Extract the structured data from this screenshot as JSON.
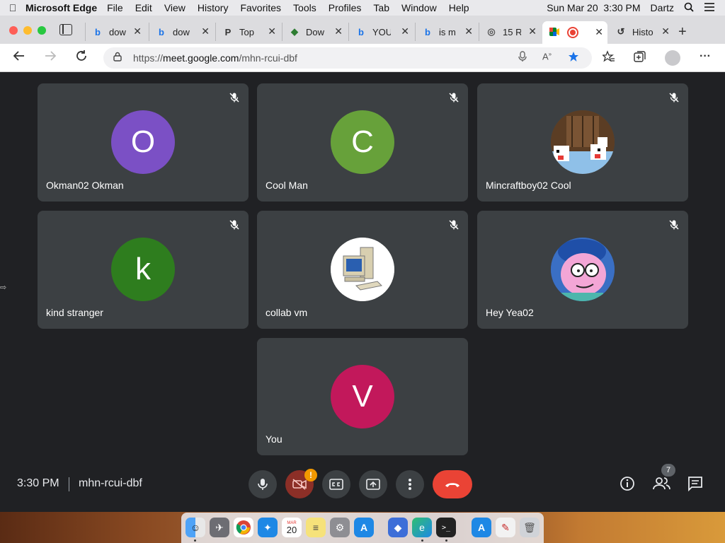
{
  "menubar": {
    "app_name": "Microsoft Edge",
    "items": [
      "File",
      "Edit",
      "View",
      "History",
      "Favorites",
      "Tools",
      "Profiles",
      "Tab",
      "Window",
      "Help"
    ],
    "datetime": "Sun Mar 20  3:30 PM",
    "user": "Dartz"
  },
  "tabs": [
    {
      "title": "dow",
      "icon": "bing-icon"
    },
    {
      "title": "dow",
      "icon": "bing-icon"
    },
    {
      "title": "Top",
      "icon": "page-icon"
    },
    {
      "title": "Dow",
      "icon": "download-icon"
    },
    {
      "title": "YOU",
      "icon": "bing-icon"
    },
    {
      "title": "is m",
      "icon": "bing-icon"
    },
    {
      "title": "15 R",
      "icon": "site-icon"
    },
    {
      "title": "",
      "icon": "google-meet-icon",
      "active": true
    },
    {
      "title": "Histo",
      "icon": "history-icon"
    }
  ],
  "address": {
    "url_prefix": "https://",
    "url_host": "meet.google.com",
    "url_path": "/mhn-rcui-dbf"
  },
  "participants": [
    {
      "name": "Okman02 Okman",
      "initial": "O",
      "color": "#7b50c5",
      "avatar": "initial"
    },
    {
      "name": "Cool Man",
      "initial": "C",
      "color": "#67a13a",
      "avatar": "initial"
    },
    {
      "name": "Mincraftboy02 Cool",
      "initial": "",
      "color": "#6b4a2f",
      "avatar": "minecraft-image"
    },
    {
      "name": "kind stranger",
      "initial": "k",
      "color": "#2e7d1e",
      "avatar": "initial"
    },
    {
      "name": "collab vm",
      "initial": "",
      "color": "#ffffff",
      "avatar": "computer-image"
    },
    {
      "name": "Hey Yea02",
      "initial": "",
      "color": "#2c5aa0",
      "avatar": "cartoon-image"
    },
    {
      "name": "You",
      "initial": "V",
      "color": "#c2185b",
      "avatar": "initial"
    }
  ],
  "bottom": {
    "time": "3:30 PM",
    "meeting_code": "mhn-rcui-dbf",
    "people_count": "7",
    "camera_warning": "!"
  },
  "colors": {
    "stage": "#202124",
    "tile": "#3c4043",
    "end_call": "#ea4335"
  }
}
